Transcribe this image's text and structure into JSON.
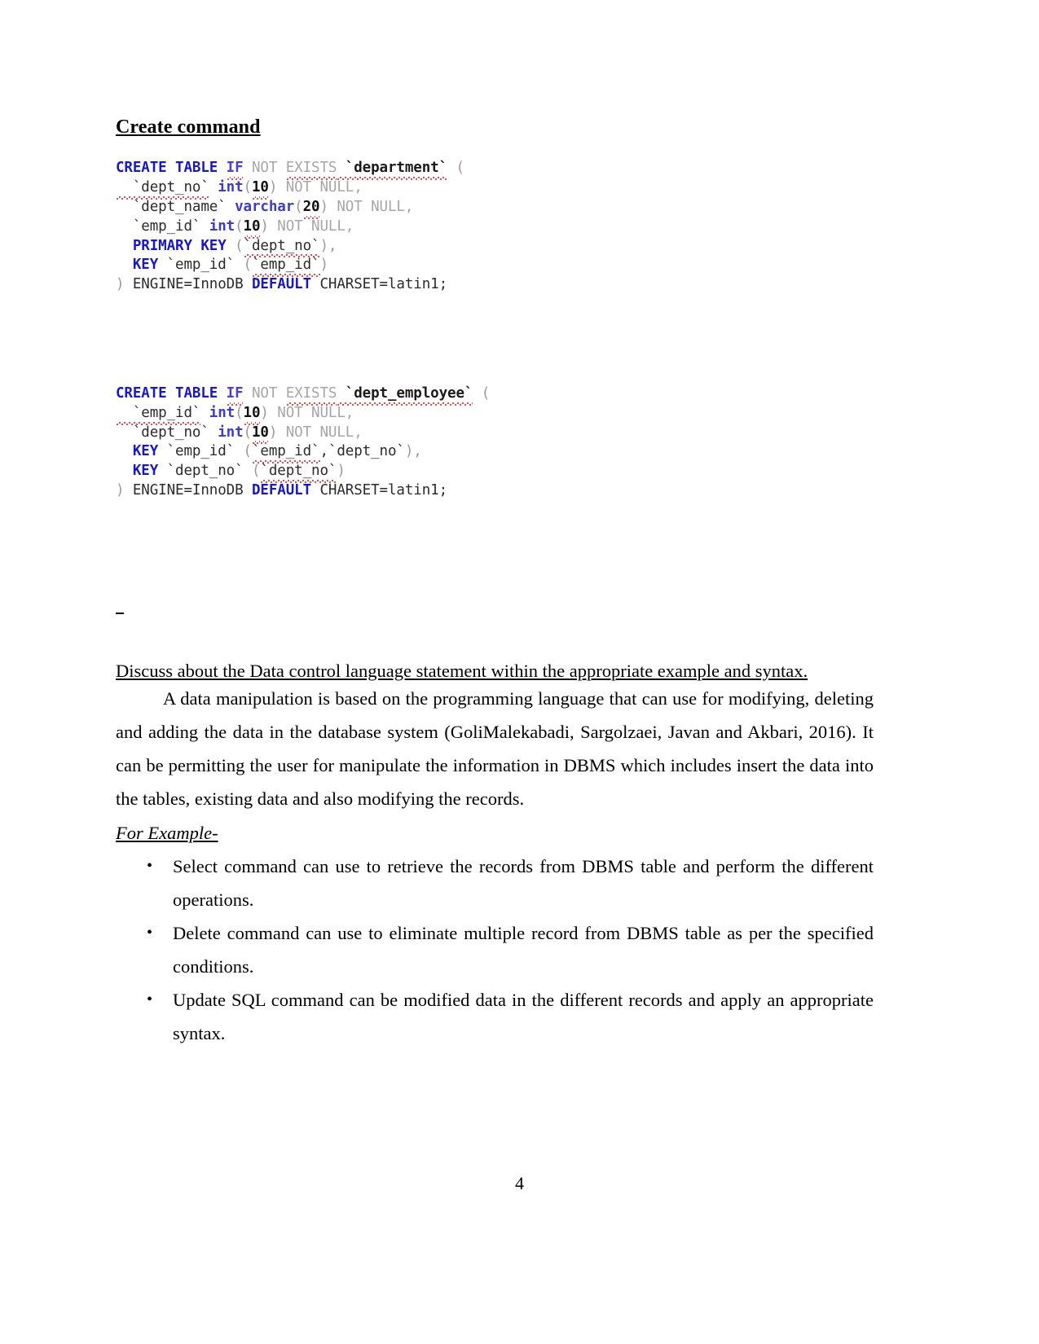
{
  "document": {
    "section_title": "Create command",
    "page_number": "4",
    "stray_mark": "-"
  },
  "code_blocks": [
    {
      "name": "create-table-department",
      "lines": [
        [
          {
            "t": "CREATE TABLE ",
            "c": "kw"
          },
          {
            "t": "IF",
            "c": "kw2",
            "squiggle": true
          },
          {
            "t": " NOT ",
            "c": "gray"
          },
          {
            "t": "EXISTS",
            "c": "gray",
            "squiggle": true
          },
          {
            "t": " `department`",
            "c": "ident",
            "squiggle": true
          },
          {
            "t": " (",
            "c": "paren"
          }
        ],
        [
          {
            "t": "  `dept_no`",
            "c": "plain",
            "squiggle": true
          },
          {
            "t": " ",
            "c": "plain"
          },
          {
            "t": "int",
            "c": "type"
          },
          {
            "t": "(",
            "c": "paren"
          },
          {
            "t": "10",
            "c": "num",
            "squiggle": true
          },
          {
            "t": ")",
            "c": "paren"
          },
          {
            "t": " NOT NULL,",
            "c": "gray"
          }
        ],
        [
          {
            "t": "  `dept_name`",
            "c": "plain"
          },
          {
            "t": " ",
            "c": "plain"
          },
          {
            "t": "varchar",
            "c": "type"
          },
          {
            "t": "(",
            "c": "paren"
          },
          {
            "t": "20",
            "c": "num",
            "squiggle": true
          },
          {
            "t": ")",
            "c": "paren"
          },
          {
            "t": " NOT NULL,",
            "c": "gray"
          }
        ],
        [
          {
            "t": "  `emp_id`",
            "c": "plain"
          },
          {
            "t": " ",
            "c": "plain"
          },
          {
            "t": "int",
            "c": "type"
          },
          {
            "t": "(",
            "c": "paren"
          },
          {
            "t": "10",
            "c": "num",
            "squiggle": true
          },
          {
            "t": ")",
            "c": "paren"
          },
          {
            "t": " NOT NULL,",
            "c": "gray"
          }
        ],
        [
          {
            "t": "  PRIMARY KEY",
            "c": "kw"
          },
          {
            "t": " (",
            "c": "paren"
          },
          {
            "t": "`dept_no`",
            "c": "plain",
            "squiggle": true
          },
          {
            "t": "),",
            "c": "paren"
          }
        ],
        [
          {
            "t": "  KEY",
            "c": "kw"
          },
          {
            "t": " `emp_id`",
            "c": "plain"
          },
          {
            "t": " (",
            "c": "paren"
          },
          {
            "t": "`emp_id`",
            "c": "plain",
            "squiggle": true
          },
          {
            "t": ")",
            "c": "paren"
          }
        ],
        [
          {
            "t": ") ",
            "c": "paren"
          },
          {
            "t": "ENGINE=InnoDB ",
            "c": "tail"
          },
          {
            "t": "DEFAULT",
            "c": "kw"
          },
          {
            "t": " CHARSET=latin1;",
            "c": "tail"
          }
        ]
      ]
    },
    {
      "name": "create-table-dept-employee",
      "lines": [
        [
          {
            "t": "CREATE TABLE ",
            "c": "kw"
          },
          {
            "t": "IF",
            "c": "kw2",
            "squiggle": true
          },
          {
            "t": " NOT ",
            "c": "gray"
          },
          {
            "t": "EXISTS",
            "c": "gray",
            "squiggle": true
          },
          {
            "t": " `dept_employee`",
            "c": "ident",
            "squiggle": true
          },
          {
            "t": " (",
            "c": "paren"
          }
        ],
        [
          {
            "t": "  `emp_id`",
            "c": "plain",
            "squiggle": true
          },
          {
            "t": " ",
            "c": "plain"
          },
          {
            "t": "int",
            "c": "type"
          },
          {
            "t": "(",
            "c": "paren"
          },
          {
            "t": "10",
            "c": "num",
            "squiggle": true
          },
          {
            "t": ")",
            "c": "paren"
          },
          {
            "t": " NOT NULL,",
            "c": "gray"
          }
        ],
        [
          {
            "t": "  `dept_no`",
            "c": "plain"
          },
          {
            "t": " ",
            "c": "plain"
          },
          {
            "t": "int",
            "c": "type"
          },
          {
            "t": "(",
            "c": "paren"
          },
          {
            "t": "10",
            "c": "num",
            "squiggle": true
          },
          {
            "t": ")",
            "c": "paren"
          },
          {
            "t": " NOT NULL,",
            "c": "gray"
          }
        ],
        [
          {
            "t": "  KEY",
            "c": "kw"
          },
          {
            "t": " `emp_id`",
            "c": "plain"
          },
          {
            "t": " (",
            "c": "paren"
          },
          {
            "t": "`emp_id`",
            "c": "plain",
            "squiggle": true
          },
          {
            "t": ",`dept_no`",
            "c": "plain"
          },
          {
            "t": "),",
            "c": "paren"
          }
        ],
        [
          {
            "t": "  KEY",
            "c": "kw"
          },
          {
            "t": " `dept_no`",
            "c": "plain"
          },
          {
            "t": " (",
            "c": "paren"
          },
          {
            "t": "`dept_no`",
            "c": "plain",
            "squiggle": true
          },
          {
            "t": ")",
            "c": "paren"
          }
        ],
        [
          {
            "t": ") ",
            "c": "paren"
          },
          {
            "t": "ENGINE=InnoDB ",
            "c": "tail"
          },
          {
            "t": "DEFAULT",
            "c": "kw"
          },
          {
            "t": " CHARSET=latin1;",
            "c": "tail"
          }
        ]
      ]
    }
  ],
  "discussion": {
    "question_heading": "Discuss about the Data control language statement within the appropriate example and syntax.",
    "paragraph": "A data manipulation is based on the programming language that can use for modifying, deleting and adding the data in the database system (GoliMalekabadi, Sargolzaei, Javan and Akbari, 2016). It can be permitting the user for manipulate the information in DBMS which includes insert the data into the tables, existing data and also modifying the records.",
    "for_example_label": "For Example- ",
    "bullet_glyph": "•",
    "bullets": [
      "Select command can use to retrieve the records from DBMS table and perform the different operations.",
      "Delete command can use to eliminate multiple record from DBMS table as per the specified conditions.",
      "Update SQL command can be modified data in the different records and apply an appropriate syntax."
    ]
  }
}
